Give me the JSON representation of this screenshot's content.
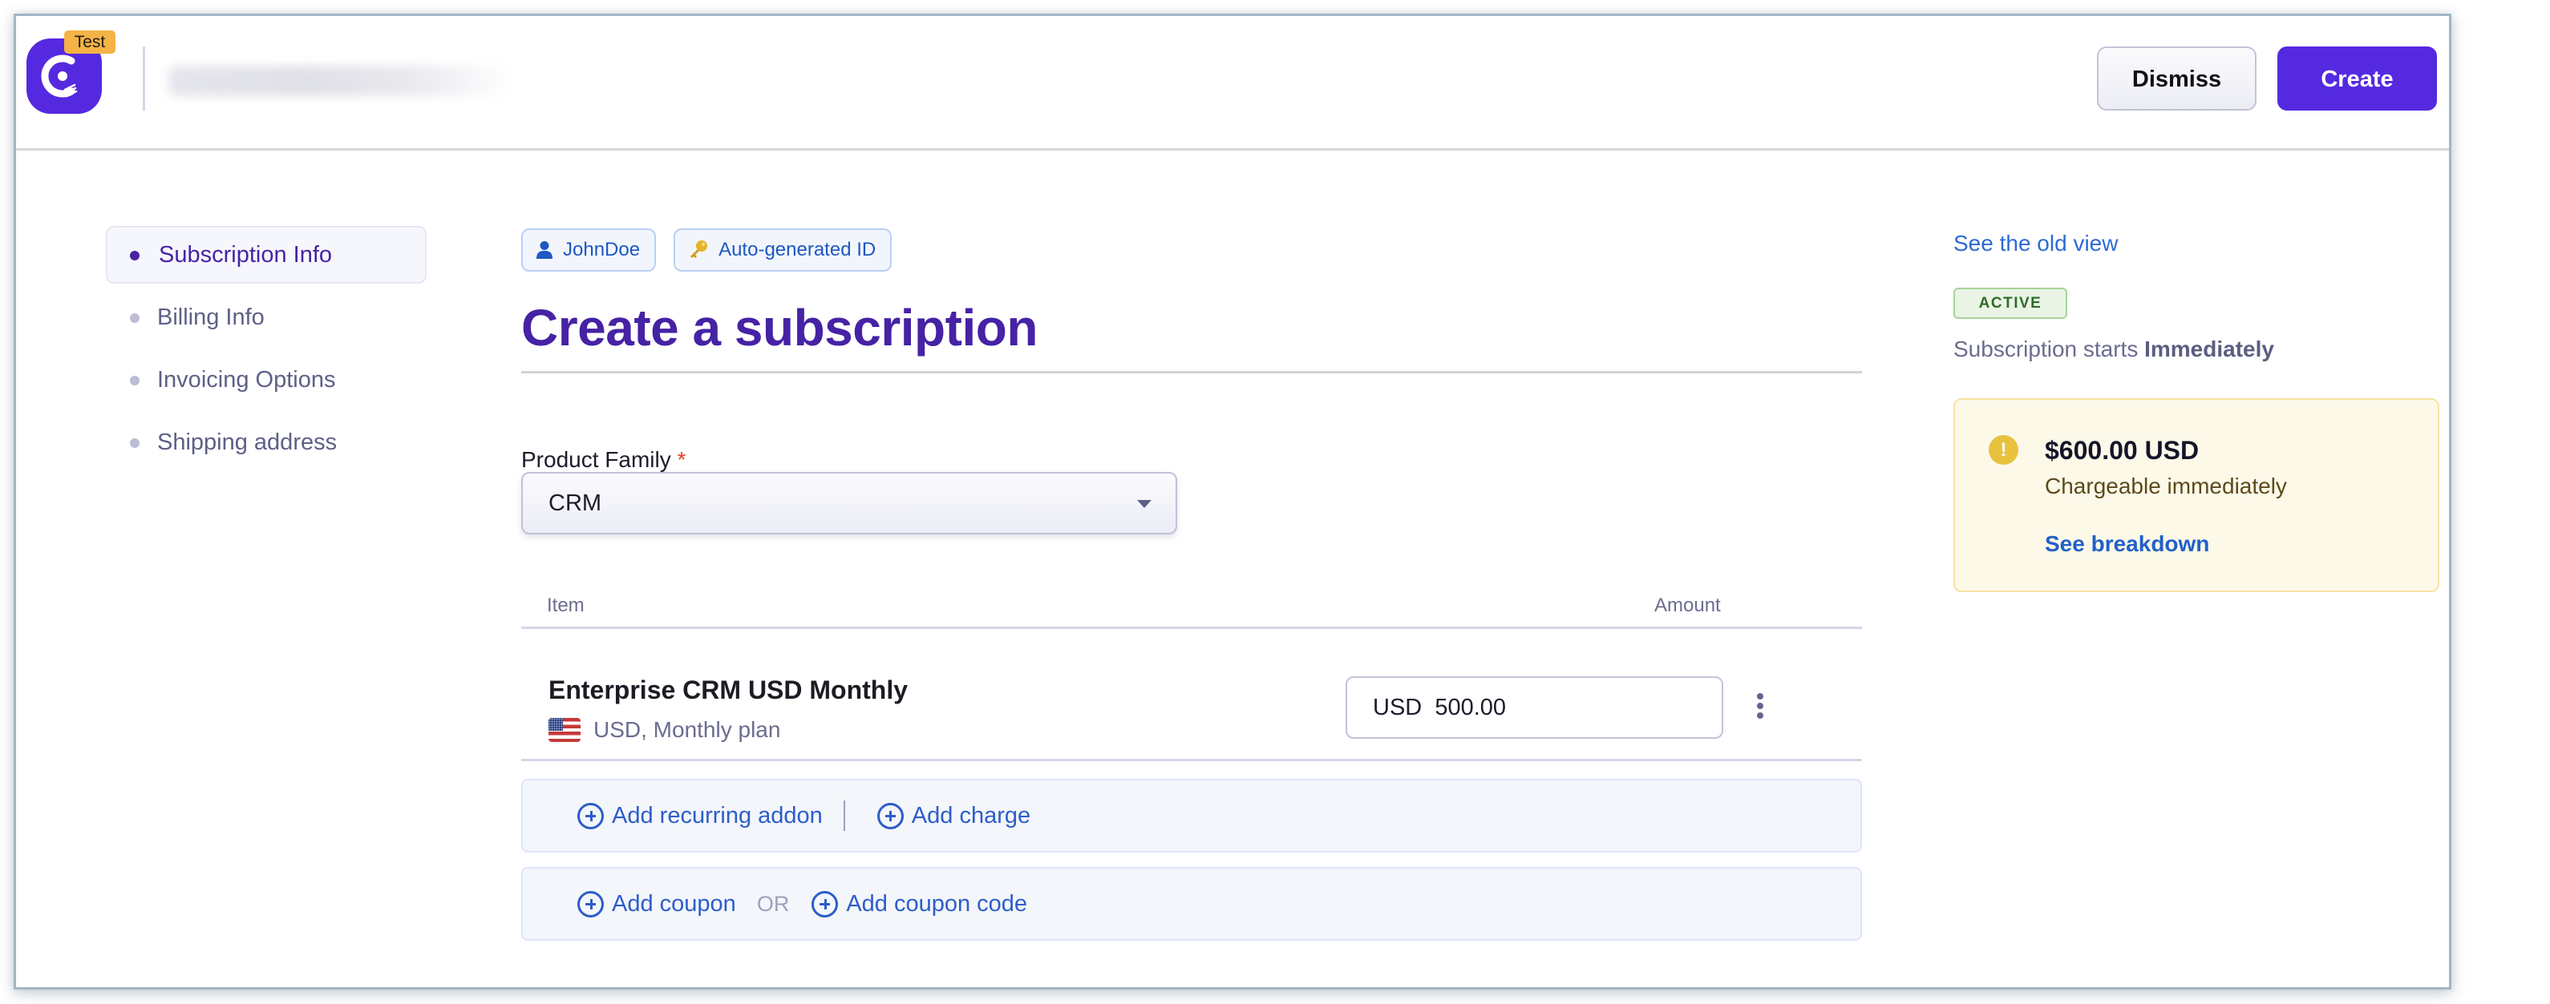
{
  "header": {
    "environment_badge": "Test",
    "buttons": {
      "dismiss": "Dismiss",
      "create": "Create"
    }
  },
  "sidebar": {
    "items": [
      {
        "label": "Subscription Info",
        "active": true
      },
      {
        "label": "Billing Info",
        "active": false
      },
      {
        "label": "Invoicing Options",
        "active": false
      },
      {
        "label": "Shipping address",
        "active": false
      }
    ]
  },
  "main": {
    "chips": [
      {
        "icon": "user-icon",
        "label": "JohnDoe"
      },
      {
        "icon": "key-icon",
        "label": "Auto-generated ID"
      }
    ],
    "title": "Create a subscription",
    "product_family": {
      "label": "Product Family",
      "required_marker": "*",
      "value": "CRM"
    },
    "table": {
      "columns": [
        "Item",
        "Amount"
      ],
      "rows": [
        {
          "name": "Enterprise CRM USD Monthly",
          "flag": "us-flag-icon",
          "details": "USD, Monthly plan",
          "currency": "USD",
          "amount": "500.00"
        }
      ]
    },
    "actions": {
      "add_recurring_addon": "Add recurring addon",
      "add_charge": "Add charge",
      "add_coupon": "Add coupon",
      "or": "OR",
      "add_coupon_code": "Add coupon code"
    }
  },
  "right_panel": {
    "old_view_link": "See the old view",
    "status": "ACTIVE",
    "starts_prefix": "Subscription starts",
    "starts_value": "Immediately",
    "charge": {
      "amount": "$600.00 USD",
      "note": "Chargeable immediately",
      "breakdown_link": "See breakdown"
    }
  },
  "colors": {
    "brand": "#5529e0",
    "title": "#4622a5",
    "link": "#2d5dc8",
    "active_badge_bg": "#e9f4e5",
    "warning": "#e9c23d",
    "test_badge": "#f5b345"
  }
}
